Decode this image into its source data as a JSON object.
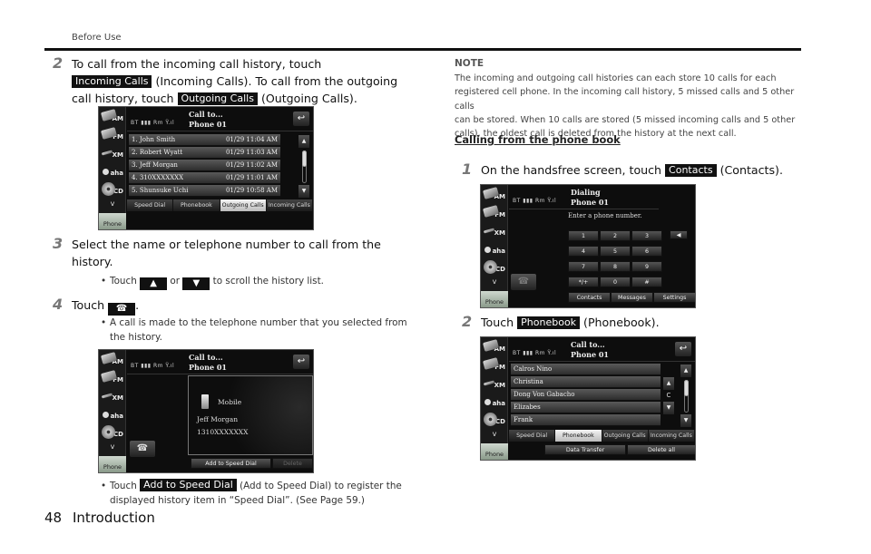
{
  "page": {
    "section_label": "Before Use",
    "page_number": "48",
    "footer_title": "Introduction"
  },
  "left": {
    "step2": {
      "num": "2",
      "line1": "To call from the incoming call history, touch",
      "kbd_incoming": "Incoming Calls",
      "line2_after": " (Incoming Calls). To call from the outgoing",
      "line3_before": "call history, touch ",
      "kbd_outgoing": "Outgoing Calls",
      "line3_after": " (Outgoing Calls)."
    },
    "step3": {
      "num": "3",
      "line1": "Select the name or telephone number to call from the",
      "line2": "history.",
      "bullet_before": "Touch ",
      "bullet_mid": " or ",
      "bullet_after": " to scroll the history list.",
      "up_glyph": "▲",
      "down_glyph": "▼"
    },
    "step4": {
      "num": "4",
      "text_before": "Touch ",
      "text_after": ".",
      "call_glyph": "☎",
      "bullet_line1": "A call is made to the telephone number that you selected from",
      "bullet_line2": "the history."
    },
    "bottom_bullet": {
      "before": "Touch ",
      "kbd": "Add to Speed Dial",
      "after": " (Add to Speed Dial) to register the",
      "line2": "displayed history item in “Speed Dial”. (See Page 59.)"
    }
  },
  "right": {
    "note_title": "NOTE",
    "note_lines": [
      "The incoming and outgoing call histories can each store 10 calls for each",
      "registered cell phone. In the incoming call history, 5 missed calls and 5 other calls",
      "can be stored. When 10 calls are stored (5 missed incoming calls and 5 other",
      "calls), the oldest call is deleted from the history at the next call."
    ],
    "subhead": "Calling from the phone book",
    "step1": {
      "num": "1",
      "before": "On the handsfree screen, touch ",
      "kbd": "Contacts",
      "after": " (Contacts)."
    },
    "step2": {
      "num": "2",
      "before": "Touch ",
      "kbd": "Phonebook",
      "after": " (Phonebook)."
    }
  },
  "sidebar": {
    "sources": [
      "AM",
      "FM",
      "XM",
      "aha",
      "CD"
    ],
    "more": "v",
    "phone": "Phone"
  },
  "status": {
    "text": "BT ▮▮▮ Rm Ÿ.ıl"
  },
  "screen_history": {
    "title1": "Call to...",
    "title2": "Phone 01",
    "back_glyph": "↩",
    "rows": [
      {
        "name": "1. John Smith",
        "time": "01/29 11:04 AM"
      },
      {
        "name": "2. Robert Wyatt",
        "time": "01/29 11:03 AM"
      },
      {
        "name": "3. Jeff Morgan",
        "time": "01/29 11:02 AM"
      },
      {
        "name": "4. 310XXXXXXX",
        "time": "01/29 11:01 AM"
      },
      {
        "name": "5. Shunsuke Uchi",
        "time": "01/29 10:58 AM"
      }
    ],
    "tabs": [
      "Speed Dial",
      "Phonebook",
      "Outgoing Calls",
      "Incoming Calls"
    ],
    "active_tab": "Outgoing Calls"
  },
  "screen_detail": {
    "title1": "Call to...",
    "title2": "Phone 01",
    "type": "Mobile",
    "name": "Jeff Morgan",
    "number": "1310XXXXXXX",
    "add_button": "Add to Speed Dial",
    "delete_button": "Delete"
  },
  "screen_dial": {
    "title1": "Dialing",
    "title2": "Phone 01",
    "prompt": "Enter a phone number.",
    "keys": [
      "1",
      "2",
      "3",
      "4",
      "5",
      "6",
      "7",
      "8",
      "9",
      "*/+",
      "0",
      "#"
    ],
    "bottom_buttons": [
      "Contacts",
      "Messages",
      "Settings"
    ]
  },
  "screen_phonebook": {
    "title1": "Call to...",
    "title2": "Phone 01",
    "rows": [
      "Calros Nino",
      "Christina",
      "Dong Von Gabacho",
      "Elizabes",
      "Frank"
    ],
    "index_letter": "C",
    "tabs": [
      "Speed Dial",
      "Phonebook",
      "Outgoing Calls",
      "Incoming Calls"
    ],
    "active_tab": "Phonebook",
    "bottom_buttons": [
      "Data Transfer",
      "Delete all"
    ]
  }
}
